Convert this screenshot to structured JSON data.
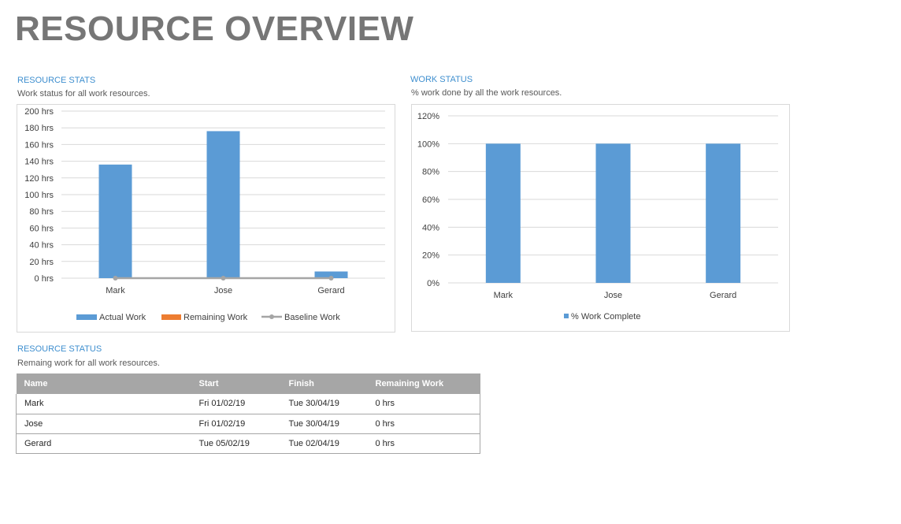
{
  "page": {
    "title": "RESOURCE OVERVIEW"
  },
  "resource_stats": {
    "title": "RESOURCE STATS",
    "subtitle": "Work status for all work resources."
  },
  "work_status": {
    "title": "WORK STATUS",
    "subtitle": "% work done by all the work resources."
  },
  "resource_status": {
    "title": "RESOURCE STATUS",
    "subtitle": "Remaing work for all work resources.",
    "columns": [
      "Name",
      "Start",
      "Finish",
      "Remaining Work"
    ],
    "rows": [
      [
        "Mark",
        "Fri 01/02/19",
        "Tue 30/04/19",
        "0 hrs"
      ],
      [
        "Jose",
        "Fri 01/02/19",
        "Tue 30/04/19",
        "0 hrs"
      ],
      [
        "Gerard",
        "Tue 05/02/19",
        "Tue 02/04/19",
        "0 hrs"
      ]
    ]
  },
  "chart_data": [
    {
      "type": "bar",
      "title": "RESOURCE STATS",
      "categories": [
        "Mark",
        "Jose",
        "Gerard"
      ],
      "series": [
        {
          "name": "Actual Work",
          "values": [
            136,
            176,
            8
          ],
          "color": "#5b9bd5",
          "kind": "bar"
        },
        {
          "name": "Remaining Work",
          "values": [
            0,
            0,
            0
          ],
          "color": "#ed7d31",
          "kind": "bar"
        },
        {
          "name": "Baseline Work",
          "values": [
            0,
            0,
            0
          ],
          "color": "#a5a5a5",
          "kind": "line"
        }
      ],
      "ylim": [
        0,
        200
      ],
      "yticks": [
        0,
        20,
        40,
        60,
        80,
        100,
        120,
        140,
        160,
        180,
        200
      ],
      "ytick_labels": [
        "0 hrs",
        "20 hrs",
        "40 hrs",
        "60 hrs",
        "80 hrs",
        "100 hrs",
        "120 hrs",
        "140 hrs",
        "160 hrs",
        "180 hrs",
        "200 hrs"
      ],
      "grid": true,
      "legend": "bottom"
    },
    {
      "type": "bar",
      "title": "WORK STATUS",
      "categories": [
        "Mark",
        "Jose",
        "Gerard"
      ],
      "series": [
        {
          "name": "% Work Complete",
          "values": [
            100,
            100,
            100
          ],
          "color": "#5b9bd5",
          "kind": "bar"
        }
      ],
      "ylim": [
        0,
        120
      ],
      "yticks": [
        0,
        20,
        40,
        60,
        80,
        100,
        120
      ],
      "ytick_labels": [
        "0%",
        "20%",
        "40%",
        "60%",
        "80%",
        "100%",
        "120%"
      ],
      "grid": true,
      "legend": "bottom"
    }
  ]
}
